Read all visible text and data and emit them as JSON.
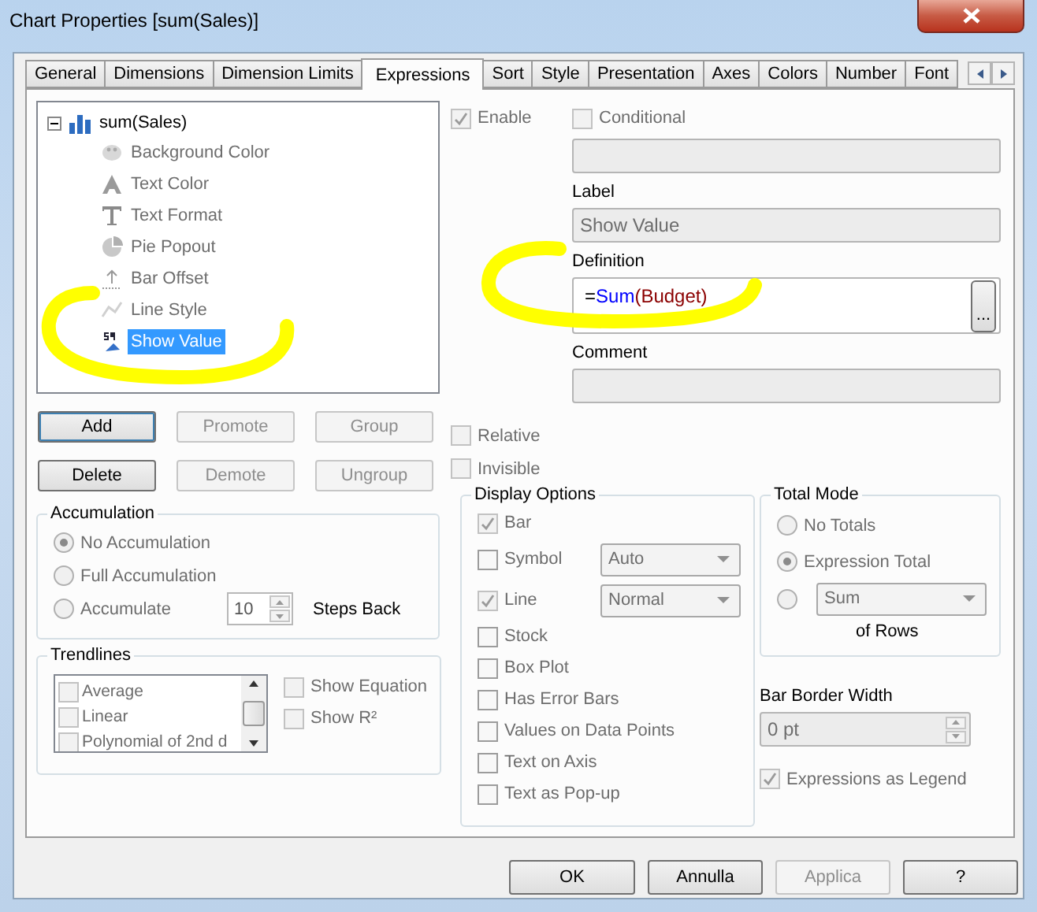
{
  "window": {
    "title": "Chart Properties [sum(Sales)]"
  },
  "tabs": [
    {
      "label": "General",
      "selected": false
    },
    {
      "label": "Dimensions",
      "selected": false
    },
    {
      "label": "Dimension Limits",
      "selected": false
    },
    {
      "label": "Expressions",
      "selected": true
    },
    {
      "label": "Sort",
      "selected": false
    },
    {
      "label": "Style",
      "selected": false
    },
    {
      "label": "Presentation",
      "selected": false
    },
    {
      "label": "Axes",
      "selected": false
    },
    {
      "label": "Colors",
      "selected": false
    },
    {
      "label": "Number",
      "selected": false
    },
    {
      "label": "Font",
      "selected": false
    }
  ],
  "expression_tree": {
    "label": "sum(Sales)",
    "expanded": true,
    "children": [
      {
        "label": "Background Color",
        "kind": "palette",
        "selected": false
      },
      {
        "label": "Text Color",
        "kind": "letter-a",
        "selected": false
      },
      {
        "label": "Text Format",
        "kind": "letter-t",
        "selected": false
      },
      {
        "label": "Pie Popout",
        "kind": "pie",
        "selected": false
      },
      {
        "label": "Bar Offset",
        "kind": "offset",
        "selected": false
      },
      {
        "label": "Line Style",
        "kind": "line",
        "selected": false
      },
      {
        "label": "Show Value",
        "kind": "value",
        "selected": true
      }
    ]
  },
  "expression_buttons": [
    {
      "label": "Add",
      "disabled": false
    },
    {
      "label": "Promote",
      "disabled": true
    },
    {
      "label": "Group",
      "disabled": true
    },
    {
      "label": "Delete",
      "disabled": false
    },
    {
      "label": "Demote",
      "disabled": true
    },
    {
      "label": "Ungroup",
      "disabled": true
    }
  ],
  "accumulation": {
    "title": "Accumulation",
    "options": [
      {
        "label": "No Accumulation",
        "selected": true
      },
      {
        "label": "Full Accumulation",
        "selected": false
      },
      {
        "label": "Accumulate",
        "selected": false
      }
    ],
    "steps": {
      "value": "10",
      "label": "Steps Back"
    }
  },
  "trendlines": {
    "title": "Trendlines",
    "items": [
      {
        "label": "Average",
        "checked": false
      },
      {
        "label": "Linear",
        "checked": false
      },
      {
        "label": "Polynomial of 2nd d",
        "checked": false
      }
    ],
    "options": [
      {
        "label": "Show Equation",
        "checked": false
      },
      {
        "label": "Show R²",
        "checked": false
      }
    ]
  },
  "enable": {
    "label": "Enable",
    "checked": true,
    "disabled": true
  },
  "conditional": {
    "label": "Conditional",
    "checked": false
  },
  "label": {
    "caption": "Label",
    "value": "Show Value"
  },
  "definition": {
    "caption": "Definition",
    "tokens": [
      {
        "text": "=",
        "kind": "operator"
      },
      {
        "text": "Sum",
        "kind": "function"
      },
      {
        "text": "(Budget)",
        "kind": "field"
      }
    ],
    "button": "..."
  },
  "comment": {
    "caption": "Comment"
  },
  "flags": [
    {
      "label": "Relative",
      "checked": false
    },
    {
      "label": "Invisible",
      "checked": false
    }
  ],
  "display_options": {
    "title": "Display Options",
    "items": [
      {
        "label": "Bar",
        "checked": true,
        "disabled": true
      },
      {
        "label": "Symbol",
        "checked": false,
        "disabled": false,
        "select": "Auto"
      },
      {
        "label": "Line",
        "checked": true,
        "disabled": true,
        "select": "Normal"
      },
      {
        "label": "Stock",
        "checked": false,
        "disabled": false
      },
      {
        "label": "Box Plot",
        "checked": false,
        "disabled": false
      },
      {
        "label": "Has Error Bars",
        "checked": false,
        "disabled": false
      },
      {
        "label": "Values on Data Points",
        "checked": false,
        "disabled": false
      },
      {
        "label": "Text on Axis",
        "checked": false,
        "disabled": false
      },
      {
        "label": "Text as Pop-up",
        "checked": false,
        "disabled": false
      }
    ]
  },
  "total_mode": {
    "title": "Total Mode",
    "options": [
      {
        "label": "No Totals",
        "selected": false
      },
      {
        "label": "Expression Total",
        "selected": true
      },
      {
        "select": "Sum",
        "suffix": "of Rows",
        "selected": false
      }
    ]
  },
  "bar_border_width": {
    "caption": "Bar Border Width",
    "value": "0 pt"
  },
  "expressions_as_legend": {
    "label": "Expressions as Legend",
    "checked": true,
    "disabled": true
  },
  "footer_buttons": [
    {
      "label": "OK",
      "disabled": false
    },
    {
      "label": "Annulla",
      "disabled": false
    },
    {
      "label": "Applica",
      "disabled": true
    },
    {
      "label": "?",
      "disabled": false
    }
  ]
}
